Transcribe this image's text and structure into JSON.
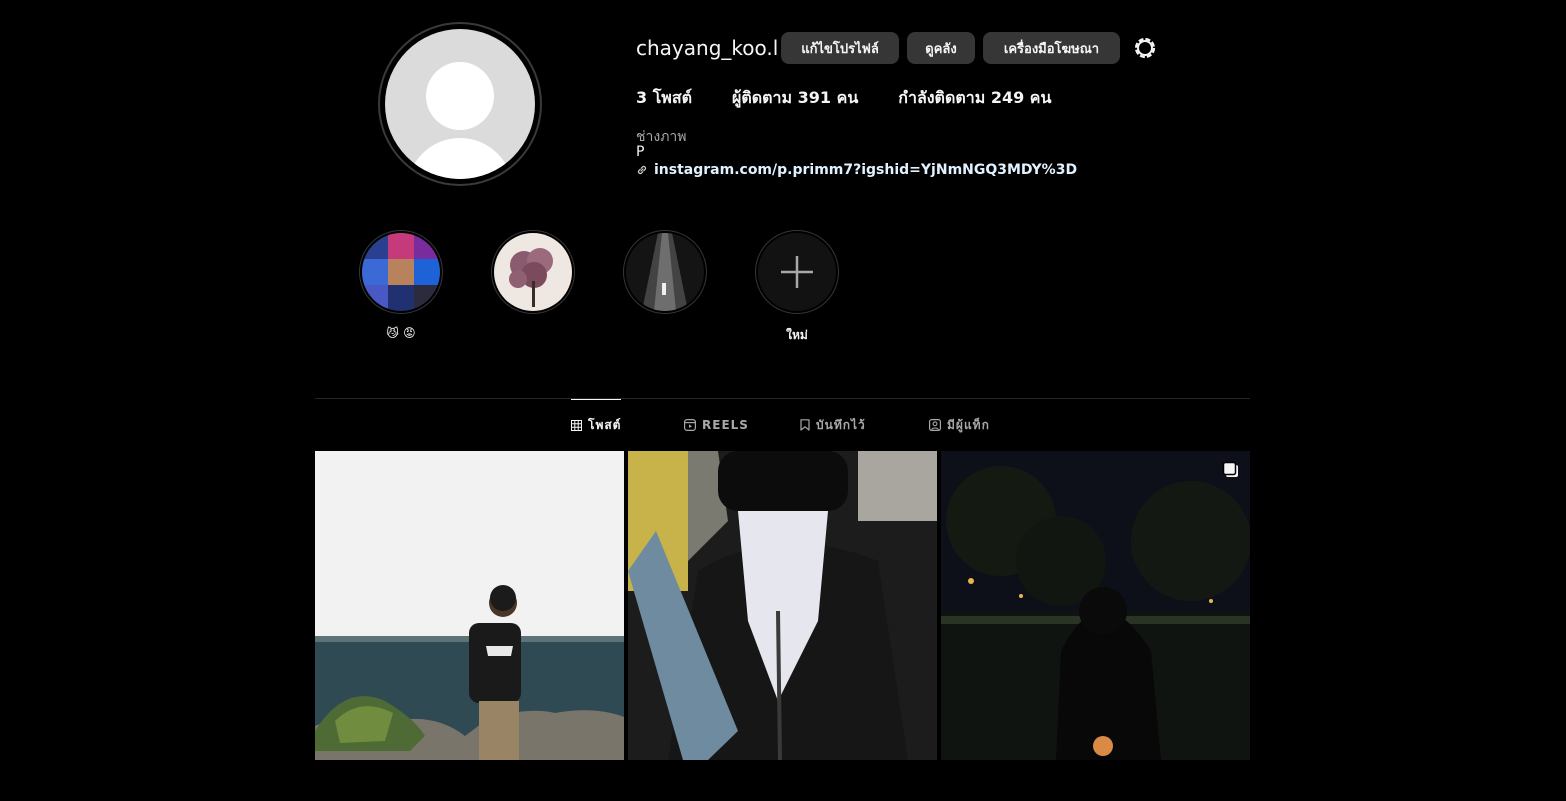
{
  "profile": {
    "username": "chayang_koo.l",
    "edit_label": "แก้ไขโปรไฟล์",
    "archive_label": "ดูคลัง",
    "ad_tools_label": "เครื่องมือโฆษณา"
  },
  "stats": {
    "posts": "3 โพสต์",
    "followers": "ผู้ติดตาม 391 คน",
    "following": "กำลังติดตาม 249 คน"
  },
  "bio": {
    "category": "ช่างภาพ",
    "name": "P",
    "link": "instagram.com/p.primm7?igshid=YjNmNGQ3MDY%3D"
  },
  "highlights": [
    {
      "label": "😼 😡"
    },
    {
      "label": ""
    },
    {
      "label": ""
    },
    {
      "label": "ใหม่"
    }
  ],
  "tabs": [
    {
      "label": "โพสต์",
      "icon": "grid-icon",
      "active": true
    },
    {
      "label": "REELS",
      "icon": "reels-icon",
      "active": false
    },
    {
      "label": "บันทึกไว้",
      "icon": "bookmark-icon",
      "active": false
    },
    {
      "label": "มีผู้แท็ก",
      "icon": "tagged-icon",
      "active": false
    }
  ],
  "colors": {
    "background": "#000000",
    "button": "#363636",
    "muted_text": "#a8a8a8",
    "link_text": "#e0f1ff"
  }
}
